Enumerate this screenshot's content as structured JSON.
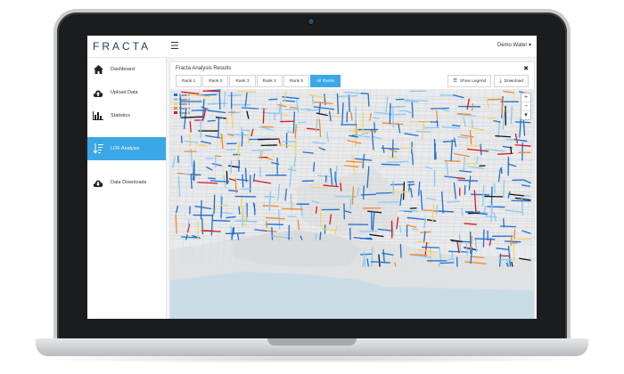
{
  "app": {
    "logo": "FRACTA",
    "user_menu": "Demo Water ▾"
  },
  "sidebar": {
    "items": [
      {
        "label": "Dashboard",
        "icon": "home-icon",
        "active": false
      },
      {
        "label": "Upload Data",
        "icon": "cloud-upload-icon",
        "active": false
      },
      {
        "label": "Statistics",
        "icon": "bar-chart-icon",
        "active": false
      },
      {
        "label": "LOF Analysis",
        "icon": "sort-list-icon",
        "active": true
      },
      {
        "label": "Data Downloads",
        "icon": "cloud-download-icon",
        "active": false
      }
    ]
  },
  "panel": {
    "title": "Fracta Analysis Results",
    "close_label": "✖",
    "tabs": [
      {
        "label": "Rank 1",
        "active": false
      },
      {
        "label": "Rank 2",
        "active": false
      },
      {
        "label": "Rank 3",
        "active": false
      },
      {
        "label": "Rank 4",
        "active": false
      },
      {
        "label": "Rank 5",
        "active": false
      },
      {
        "label": "All Ranks",
        "active": true
      }
    ],
    "show_legend_label": "Show Legend",
    "download_label": "Download"
  },
  "map": {
    "legend": [
      {
        "label": "Rank 1",
        "color": "#1f6fd1"
      },
      {
        "label": "Rank 2",
        "color": "#8cc8f2"
      },
      {
        "label": "Rank 3",
        "color": "#f1d36a"
      },
      {
        "label": "Rank 4",
        "color": "#f08a2c"
      },
      {
        "label": "Rank 5",
        "color": "#d7191c"
      }
    ],
    "zoom_in": "+",
    "zoom_out": "−",
    "compass": "▾"
  },
  "colors": {
    "accent": "#3aa7e6",
    "water": "#c9dce6",
    "land": "#e9eaeb"
  }
}
